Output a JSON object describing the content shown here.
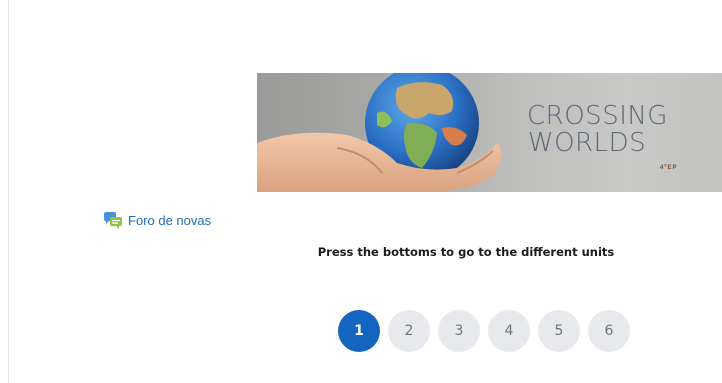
{
  "banner": {
    "title_line1": "CROSSING",
    "title_line2": "WORLDS",
    "subtitle": "4ºEP"
  },
  "forum": {
    "icon": "forum-chat-icon",
    "label": "Foro de novas"
  },
  "instruction": "Press the bottoms to go to the different units",
  "units": {
    "active_index": 0,
    "active_color": "#1465c0",
    "inactive_color": "#e7e9ed",
    "buttons": [
      {
        "label": "1"
      },
      {
        "label": "2"
      },
      {
        "label": "3"
      },
      {
        "label": "4"
      },
      {
        "label": "5"
      },
      {
        "label": "6"
      }
    ]
  },
  "colors": {
    "link": "#1f6fb9",
    "banner_text": "#5d6775"
  }
}
